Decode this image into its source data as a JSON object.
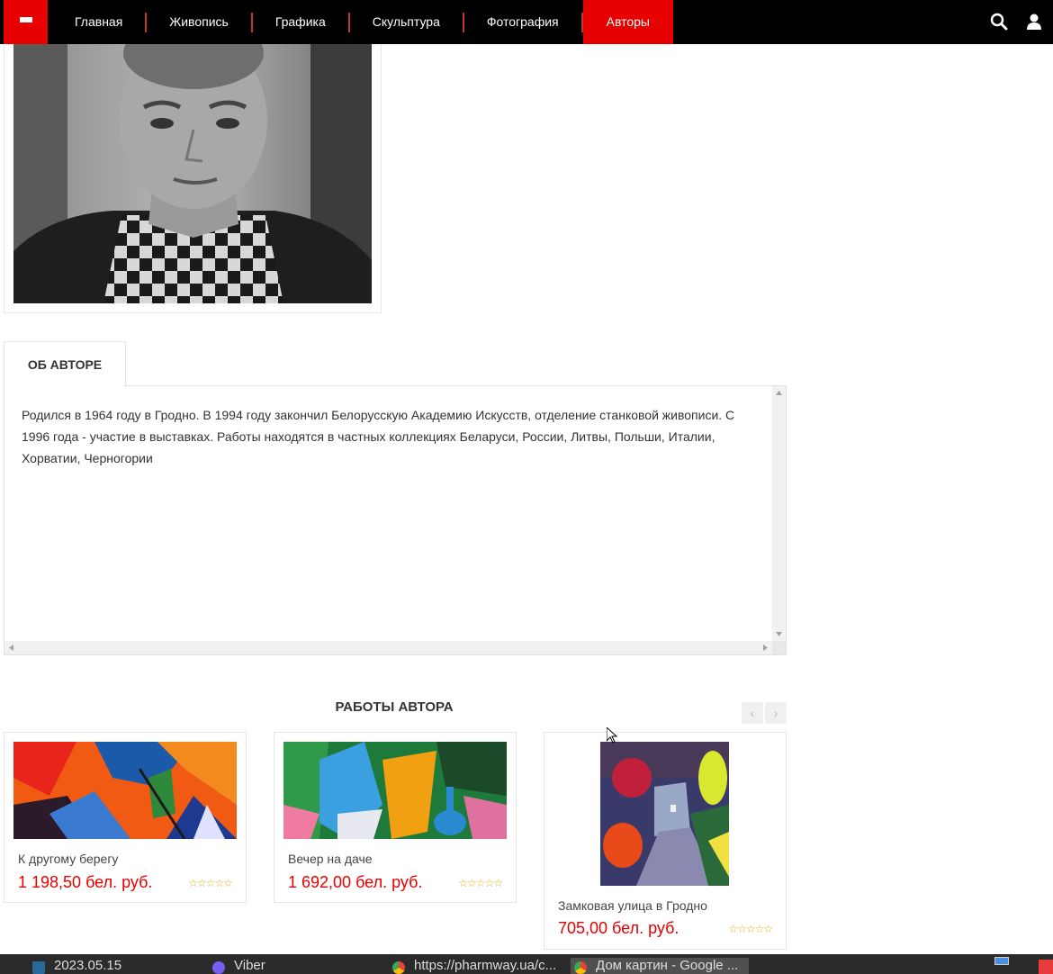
{
  "nav": {
    "items": [
      "Главная",
      "Живопись",
      "Графика",
      "Скульптура",
      "Фотография",
      "Авторы"
    ],
    "active": "Авторы"
  },
  "about": {
    "tab_label": "ОБ АВТОРЕ",
    "text": "Родился в 1964 году в Гродно. В 1994 году закончил Белорусскую Академию Искусств, отделение станковой живописи. С 1996 года - участие в выставках. Работы находятся в частных коллекциях Беларуси, России, Литвы, Польши, Италии, Хорватии, Черногории"
  },
  "works": {
    "title": "РАБОТЫ АВТОРА",
    "items": [
      {
        "name": "К другому берегу",
        "price": "1 198,50 бел. руб.",
        "rating": 0
      },
      {
        "name": "Вечер на даче",
        "price": "1 692,00 бел. руб.",
        "rating": 0
      },
      {
        "name": "Замковая улица в Гродно",
        "price": "705,00 бел. руб.",
        "rating": 0
      }
    ]
  },
  "taskbar": {
    "items": [
      "2023.05.15",
      "Viber",
      "https://pharmway.ua/c...",
      "Дом картин - Google ..."
    ]
  },
  "colors": {
    "accent": "#e60000",
    "nav_bg": "#000000",
    "stars": "#e6a817"
  }
}
